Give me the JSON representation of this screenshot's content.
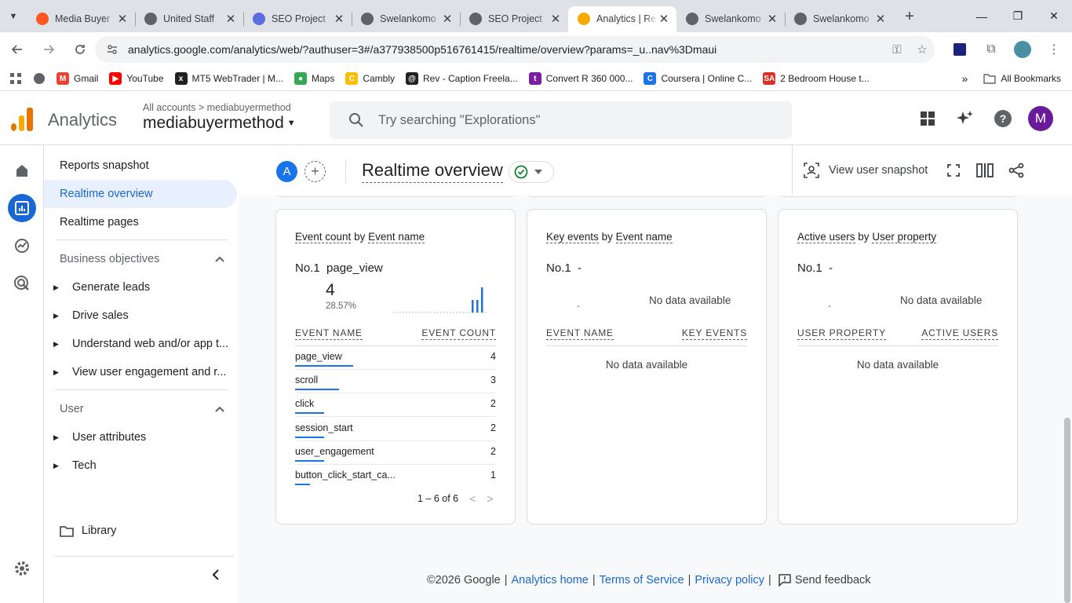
{
  "browser": {
    "tabs": [
      {
        "title": "Media Buyer",
        "color": "#ff5722"
      },
      {
        "title": "United Staff",
        "color": "#5f6368"
      },
      {
        "title": "SEO Project",
        "color": "#5b6ee1"
      },
      {
        "title": "Swelankomo",
        "color": "#5f6368"
      },
      {
        "title": "SEO Project",
        "color": "#5f6368"
      },
      {
        "title": "Analytics | Re",
        "color": "#f9ab00"
      },
      {
        "title": "Swelankomo",
        "color": "#5f6368"
      },
      {
        "title": "Swelankomo",
        "color": "#5f6368"
      }
    ],
    "url": "analytics.google.com/analytics/web/?authuser=3#/a377938500p516761415/realtime/overview?params=_u..nav%3Dmaui",
    "bookmarks": [
      {
        "label": "Gmail",
        "color": "#ea4335",
        "glyph": "M"
      },
      {
        "label": "YouTube",
        "color": "#ff0000",
        "glyph": "▶"
      },
      {
        "label": "MT5 WebTrader | M...",
        "color": "#202124",
        "glyph": "x"
      },
      {
        "label": "Maps",
        "color": "#34a853",
        "glyph": "●"
      },
      {
        "label": "Cambly",
        "color": "#fbbc04",
        "glyph": "C"
      },
      {
        "label": "Rev - Caption Freela...",
        "color": "#202124",
        "glyph": "@"
      },
      {
        "label": "Convert R 360 000...",
        "color": "#7b1fa2",
        "glyph": "t"
      },
      {
        "label": "Coursera | Online C...",
        "color": "#1a73e8",
        "glyph": "C"
      },
      {
        "label": "2 Bedroom House t...",
        "color": "#d93025",
        "glyph": "SA"
      }
    ],
    "all_bookmarks": "All Bookmarks"
  },
  "header": {
    "brand": "Analytics",
    "breadcrumb_all": "All accounts",
    "breadcrumb_account": "mediabuyermethod",
    "property": "mediabuyermethod",
    "search_placeholder": "Try searching \"Explorations\"",
    "avatar_letter": "M"
  },
  "nav": {
    "reports_snapshot": "Reports snapshot",
    "realtime_overview": "Realtime overview",
    "realtime_pages": "Realtime pages",
    "business_objectives": "Business objectives",
    "business_items": [
      "Generate leads",
      "Drive sales",
      "Understand web and/or app t...",
      "View user engagement and r..."
    ],
    "user": "User",
    "user_items": [
      "User attributes",
      "Tech"
    ],
    "library": "Library"
  },
  "page": {
    "segment_letter": "A",
    "title": "Realtime overview",
    "view_user_snapshot": "View user snapshot"
  },
  "cards": {
    "events": {
      "title_a": "Event count",
      "title_by": "by",
      "title_b": "Event name",
      "rank_no": "No.1",
      "rank_name": "page_view",
      "top_value": "4",
      "top_pct": "28.57%",
      "col1": "EVENT NAME",
      "col2": "EVENT COUNT",
      "rows": [
        {
          "name": "page_view",
          "count": "4",
          "fraction": 1.0
        },
        {
          "name": "scroll",
          "count": "3",
          "fraction": 0.75
        },
        {
          "name": "click",
          "count": "2",
          "fraction": 0.5
        },
        {
          "name": "session_start",
          "count": "2",
          "fraction": 0.5
        },
        {
          "name": "user_engagement",
          "count": "2",
          "fraction": 0.5
        },
        {
          "name": "button_click_start_ca...",
          "count": "1",
          "fraction": 0.25
        }
      ],
      "pager": "1 – 6 of 6"
    },
    "key_events": {
      "title_a": "Key events",
      "title_by": "by",
      "title_b": "Event name",
      "rank_no": "No.1",
      "rank_name": "-",
      "dash": "-",
      "no_data": "No data available",
      "col1": "EVENT NAME",
      "col2": "KEY EVENTS",
      "table_no_data": "No data available"
    },
    "active_users": {
      "title_a": "Active users",
      "title_by": "by",
      "title_b": "User property",
      "rank_no": "No.1",
      "rank_name": "-",
      "dash": "-",
      "no_data": "No data available",
      "col1": "USER PROPERTY",
      "col2": "ACTIVE USERS",
      "table_no_data": "No data available"
    }
  },
  "footer": {
    "copyright": "©2026 Google",
    "analytics_home": "Analytics home",
    "terms": "Terms of Service",
    "privacy": "Privacy policy",
    "feedback": "Send feedback",
    "sep": "|"
  }
}
